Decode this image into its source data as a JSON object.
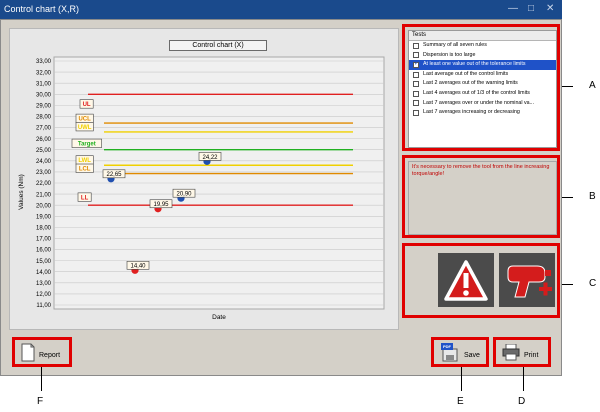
{
  "window": {
    "title": "Control chart (X,R)",
    "controls": [
      "—",
      "□",
      "✕"
    ]
  },
  "chart_data": {
    "type": "scatter",
    "title": "Control chart (X)",
    "xlabel": "Date",
    "ylabel": "Values (Nm)",
    "ylim": [
      11,
      33
    ],
    "yticks": [
      "11,00",
      "12,00",
      "13,00",
      "14,00",
      "15,00",
      "16,00",
      "17,00",
      "18,00",
      "19,00",
      "20,00",
      "21,00",
      "22,00",
      "23,00",
      "24,00",
      "25,00",
      "26,00",
      "27,00",
      "28,00",
      "29,00",
      "30,00",
      "31,00",
      "32,00",
      "33,00"
    ],
    "grid": true,
    "limit_lines": [
      {
        "label": "UL",
        "value": 30.0,
        "color": "#e02020"
      },
      {
        "label": "UCL",
        "value": 27.4,
        "color": "#e08a00"
      },
      {
        "label": "UWL",
        "value": 26.6,
        "color": "#f0d000"
      },
      {
        "label": "Target",
        "value": 25.0,
        "color": "#20b020"
      },
      {
        "label": "LWL",
        "value": 23.6,
        "color": "#f0d000"
      },
      {
        "label": "LCL",
        "value": 22.85,
        "color": "#e08a00"
      },
      {
        "label": "LL",
        "value": 20.0,
        "color": "#e02020"
      }
    ],
    "points": [
      {
        "label": "22,65",
        "y": 22.65,
        "color": "#2050b0"
      },
      {
        "label": "14,40",
        "y": 14.4,
        "color": "#e02020"
      },
      {
        "label": "19,95",
        "y": 19.95,
        "color": "#e02020"
      },
      {
        "label": "20,90",
        "y": 20.9,
        "color": "#2050b0"
      },
      {
        "label": "24,22",
        "y": 24.22,
        "color": "#2050b0"
      }
    ]
  },
  "tests": {
    "header": "Tests",
    "items": [
      {
        "label": "Summary of all seven rules",
        "checked": false,
        "selected": false
      },
      {
        "label": "Dispersion is too large",
        "checked": false,
        "selected": false
      },
      {
        "label": "At least one value out of the tolerance limits",
        "checked": true,
        "selected": true
      },
      {
        "label": "Last average out of the control limits",
        "checked": false,
        "selected": false
      },
      {
        "label": "Last 2 averages out of the warning limits",
        "checked": false,
        "selected": false
      },
      {
        "label": "Last 4 averages out of 1/3 of the control limits",
        "checked": false,
        "selected": false
      },
      {
        "label": "Last 7 averages over or under the nominal va...",
        "checked": false,
        "selected": false
      },
      {
        "label": "Last 7 averages increasing or decreasing",
        "checked": false,
        "selected": false
      }
    ]
  },
  "message": "It's necessary to remove the tool from the line increasing torque/angle!",
  "buttons": {
    "report": "Report",
    "save": "Save",
    "print": "Print",
    "pdf_badge": "PDF"
  },
  "icons": {
    "warning": "warning-triangle-icon",
    "tool": "torque-tool-icon",
    "report": "report-doc-icon",
    "save": "save-pdf-icon",
    "print": "printer-icon"
  },
  "callouts": {
    "a": "A",
    "b": "B",
    "c": "C",
    "d": "D",
    "e": "E",
    "f": "F"
  },
  "colors": {
    "highlight": "#e00000",
    "selection": "#1f52c8",
    "message": "#c00000",
    "titlebar": "#1a4a8c"
  }
}
